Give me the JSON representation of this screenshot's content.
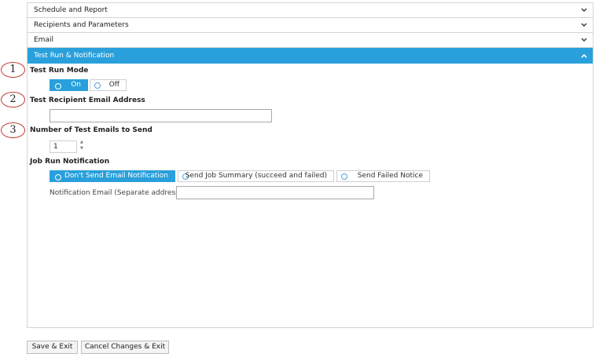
{
  "accordion": [
    {
      "label": "Schedule and Report"
    },
    {
      "label": "Recipients and Parameters"
    },
    {
      "label": "Email"
    },
    {
      "label": "Test Run & Notification"
    }
  ],
  "markers": [
    "1",
    "2",
    "3"
  ],
  "test_run_mode": {
    "label": "Test Run Mode",
    "options": [
      "On",
      "Off"
    ],
    "selected": "On"
  },
  "test_recipient": {
    "label": "Test Recipient Email Address",
    "value": ""
  },
  "test_emails": {
    "label": "Number of Test Emails to Send",
    "value": "1"
  },
  "job_run_notification": {
    "label": "Job Run Notification",
    "options": [
      "Don't Send Email Notification",
      "Send Job Summary (succeed and failed)",
      "Send Failed Notice"
    ],
    "selected": "Don't Send Email Notification",
    "email_label": "Notification Email (Separate address by ;)",
    "email_value": ""
  },
  "footer": {
    "save_label": "Save & Exit",
    "cancel_label": "Cancel Changes & Exit"
  },
  "colors": {
    "accent": "#29a0db",
    "marker": "#c0392b"
  }
}
